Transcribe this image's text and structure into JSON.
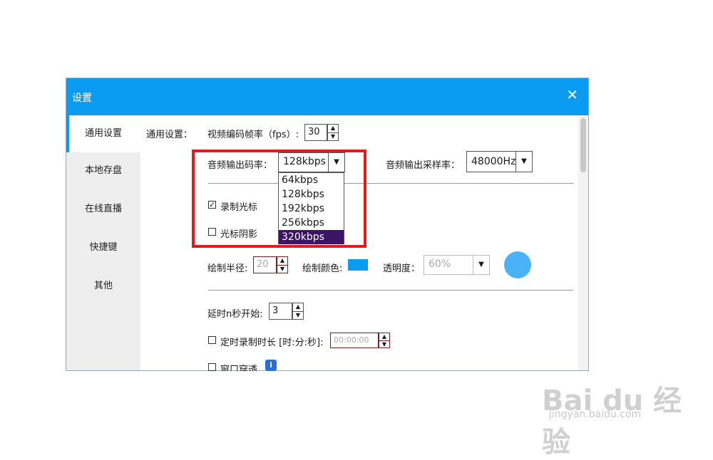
{
  "dialog": {
    "title": "设置",
    "close_glyph": "✕"
  },
  "sidebar": {
    "items": [
      {
        "label": "通用设置",
        "active": true
      },
      {
        "label": "本地存盘",
        "active": false
      },
      {
        "label": "在线直播",
        "active": false
      },
      {
        "label": "快捷键",
        "active": false
      },
      {
        "label": "其他",
        "active": false
      }
    ]
  },
  "general": {
    "section_label": "通用设置：",
    "fps_label": "视频编码帧率（fps）:",
    "fps_value": "30",
    "audio_bitrate_label": "音频输出码率：",
    "audio_bitrate_value": "128kbps",
    "audio_bitrate_options": [
      "64kbps",
      "128kbps",
      "192kbps",
      "256kbps",
      "320kbps"
    ],
    "audio_bitrate_highlighted": "320kbps",
    "sample_rate_label": "音频输出采样率：",
    "sample_rate_value": "48000Hz",
    "record_cursor_label": "录制光标",
    "record_cursor_checked": true,
    "cursor_shadow_label": "光标阴影",
    "cursor_shadow_checked": false,
    "draw_radius_label": "绘制半径:",
    "draw_radius_value": "20",
    "draw_color_label": "绘制颜色:",
    "draw_color": "#0b9cf2",
    "opacity_label": "透明度：",
    "opacity_value": "60%",
    "preview_color": "#4ab3f7",
    "delay_label": "延时n秒开始:",
    "delay_value": "3",
    "timed_record_label": "定时录制时长 [时:分:秒]:",
    "timed_record_value": "00:00:00",
    "timed_record_checked": false,
    "window_through_label": "窗口穿透",
    "window_through_checked": false
  },
  "watermark": {
    "brand": "Bai du 经验",
    "url": "jingyan.baidu.com"
  },
  "colors": {
    "accent": "#0b9cf2",
    "highlight_box": "#e01b1b",
    "selected_option": "#3b1468"
  }
}
